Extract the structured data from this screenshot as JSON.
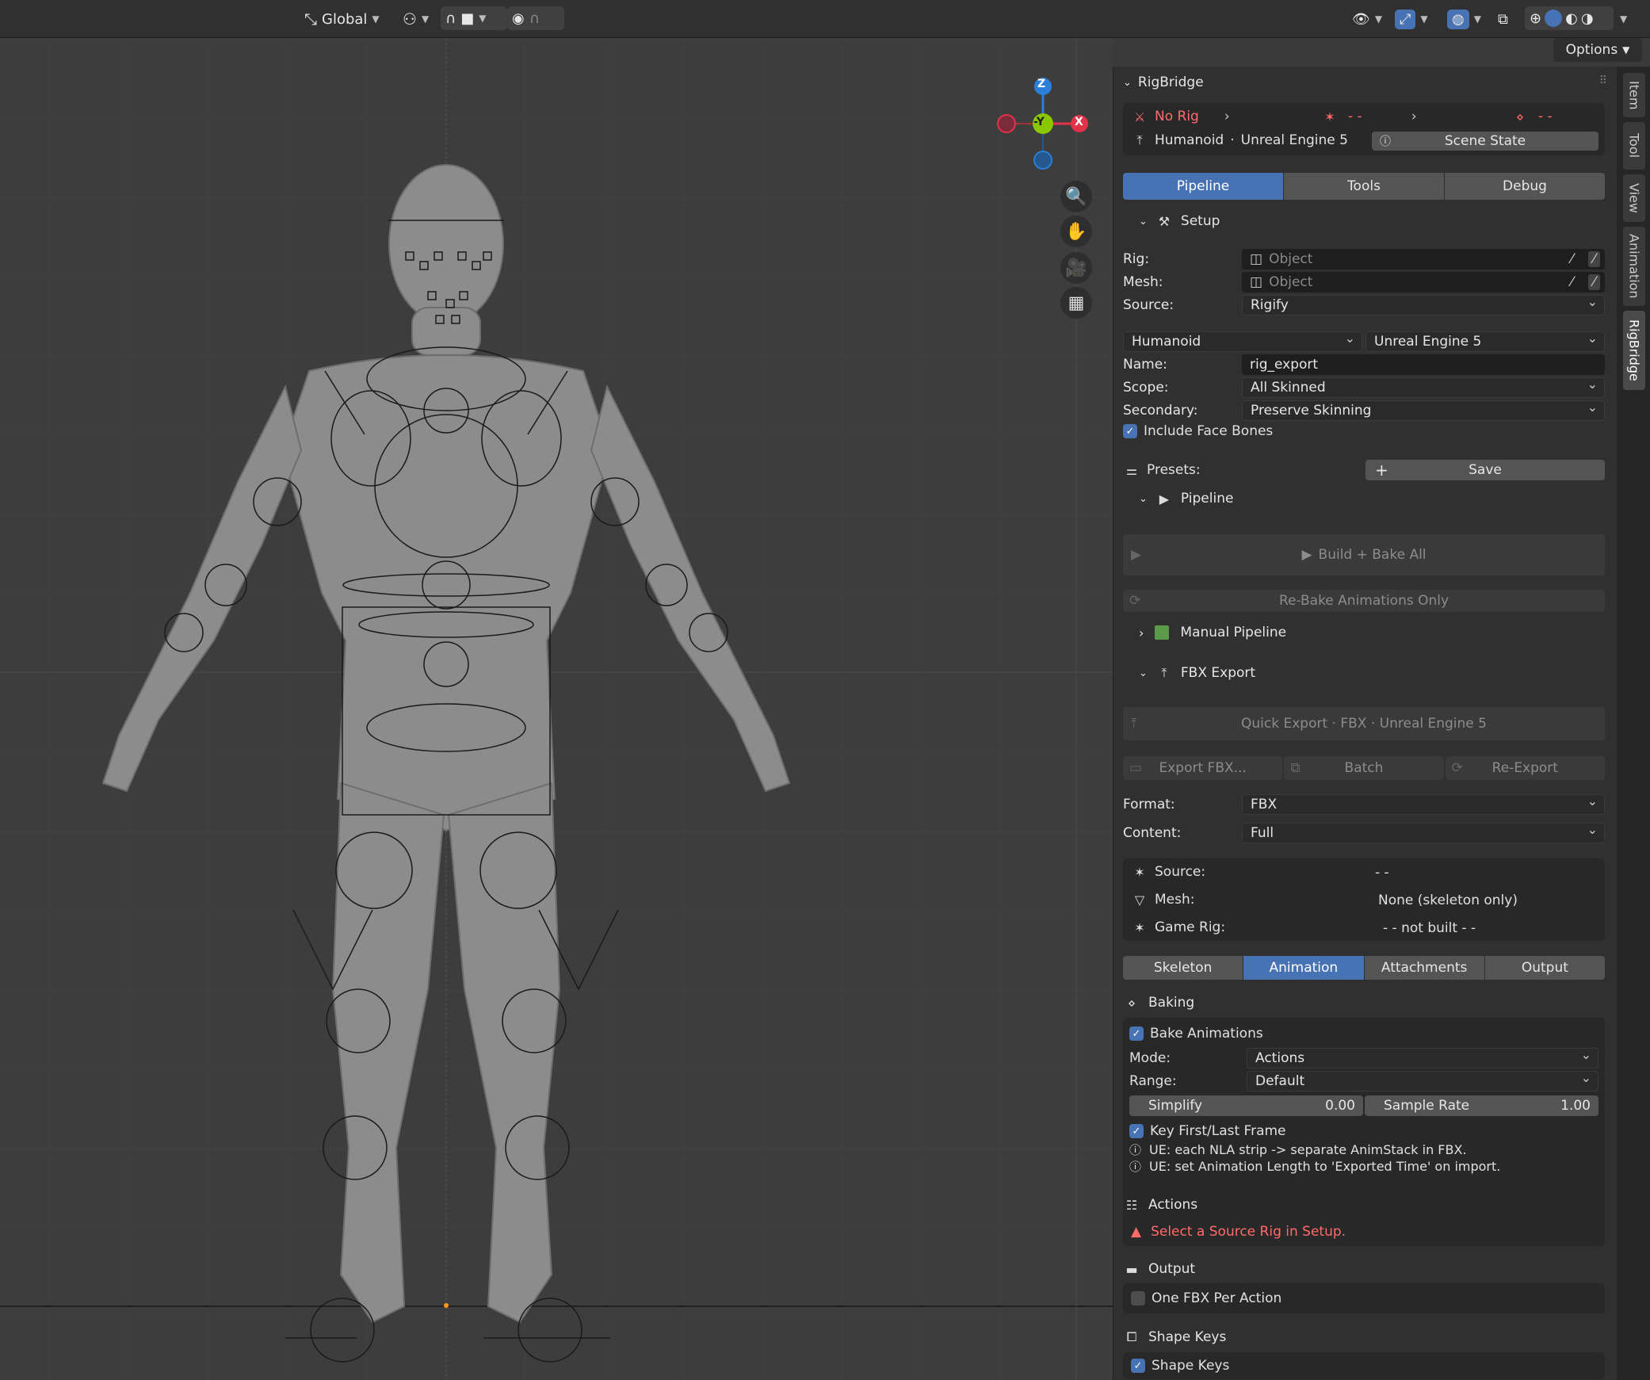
{
  "header": {
    "orientation": "Global",
    "options": "Options"
  },
  "panel": {
    "title": "RigBridge",
    "status": {
      "rig": "No Rig",
      "dash1": "- -",
      "dash2": "- -",
      "humanoid": "Humanoid",
      "engine": "Unreal Engine 5",
      "scene_state": "Scene State"
    },
    "tabs": [
      "Pipeline",
      "Tools",
      "Debug"
    ],
    "setup": {
      "title": "Setup",
      "rig_label": "Rig:",
      "rig_placeholder": "Object",
      "mesh_label": "Mesh:",
      "mesh_placeholder": "Object",
      "source_label": "Source:",
      "source_value": "Rigify",
      "profile": "Humanoid",
      "target": "Unreal Engine 5",
      "name_label": "Name:",
      "name_value": "rig_export",
      "scope_label": "Scope:",
      "scope_value": "All Skinned",
      "secondary_label": "Secondary:",
      "secondary_value": "Preserve Skinning",
      "face_bones": "Include Face Bones",
      "presets_label": "Presets:",
      "save": "Save"
    },
    "pipeline": {
      "title": "Pipeline",
      "build_bake": "Build + Bake All",
      "rebake": "Re-Bake Animations Only",
      "manual": "Manual Pipeline"
    },
    "fbx": {
      "title": "FBX Export",
      "quick": "Quick Export · FBX · Unreal Engine 5",
      "export": "Export FBX...",
      "batch": "Batch",
      "reexport": "Re-Export",
      "format_label": "Format:",
      "format_value": "FBX",
      "content_label": "Content:",
      "content_value": "Full",
      "source_label": "Source:",
      "source_value": "- -",
      "mesh_label": "Mesh:",
      "mesh_value": "None (skeleton only)",
      "gamerig_label": "Game Rig:",
      "gamerig_value": "- - not built - -"
    },
    "subtabs": [
      "Skeleton",
      "Animation",
      "Attachments",
      "Output"
    ],
    "baking": {
      "title": "Baking",
      "bake_anims": "Bake Animations",
      "mode_label": "Mode:",
      "mode_value": "Actions",
      "range_label": "Range:",
      "range_value": "Default",
      "simplify_label": "Simplify",
      "simplify_value": "0.00",
      "sample_label": "Sample Rate",
      "sample_value": "1.00",
      "key_frames": "Key First/Last Frame",
      "info1": "UE: each NLA strip -> separate AnimStack in FBX.",
      "info2": "UE: set Animation Length to 'Exported Time' on import."
    },
    "actions": {
      "title": "Actions",
      "warning": "Select a Source Rig in Setup."
    },
    "output": {
      "title": "Output",
      "one_per_action": "One FBX Per Action"
    },
    "shapekeys": {
      "title": "Shape Keys",
      "check": "Shape Keys"
    }
  },
  "vtabs": [
    "Item",
    "Tool",
    "View",
    "Animation",
    "RigBridge"
  ],
  "gizmo": {
    "z": "Z",
    "y": "-Y",
    "x": "X"
  },
  "colors": {
    "accent": "#4772b3",
    "warning": "#ff6b6b",
    "axis_x": "#e2324a",
    "axis_y": "#8bc700",
    "axis_z": "#2b7fd8"
  }
}
